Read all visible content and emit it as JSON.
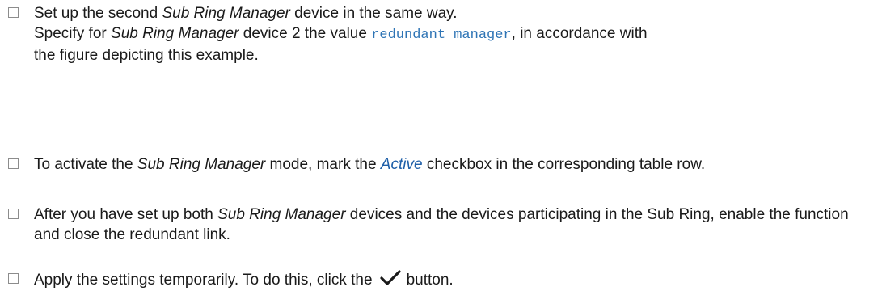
{
  "steps": [
    {
      "line1": {
        "a": "Set up the second ",
        "b": "Sub Ring Manager",
        "c": " device in the same way."
      },
      "line2": {
        "a": "Specify for ",
        "b": "Sub Ring Manager",
        "c": " device 2 the value ",
        "code": "redundant manager",
        "d": ", in accordance with"
      },
      "line3": "the figure depicting this example."
    },
    {
      "a": "To activate the ",
      "b": "Sub Ring Manager",
      "c": " mode, mark the ",
      "label": "Active",
      "d": " checkbox in the corresponding table row."
    },
    {
      "a": "After you have set up both ",
      "b": "Sub Ring Manager",
      "c": " devices and the devices participating in the Sub Ring, enable the function and close the redundant link."
    },
    {
      "a": "Apply the settings temporarily. To do this, click the",
      "icon": "checkmark-icon",
      "b": "button."
    }
  ]
}
